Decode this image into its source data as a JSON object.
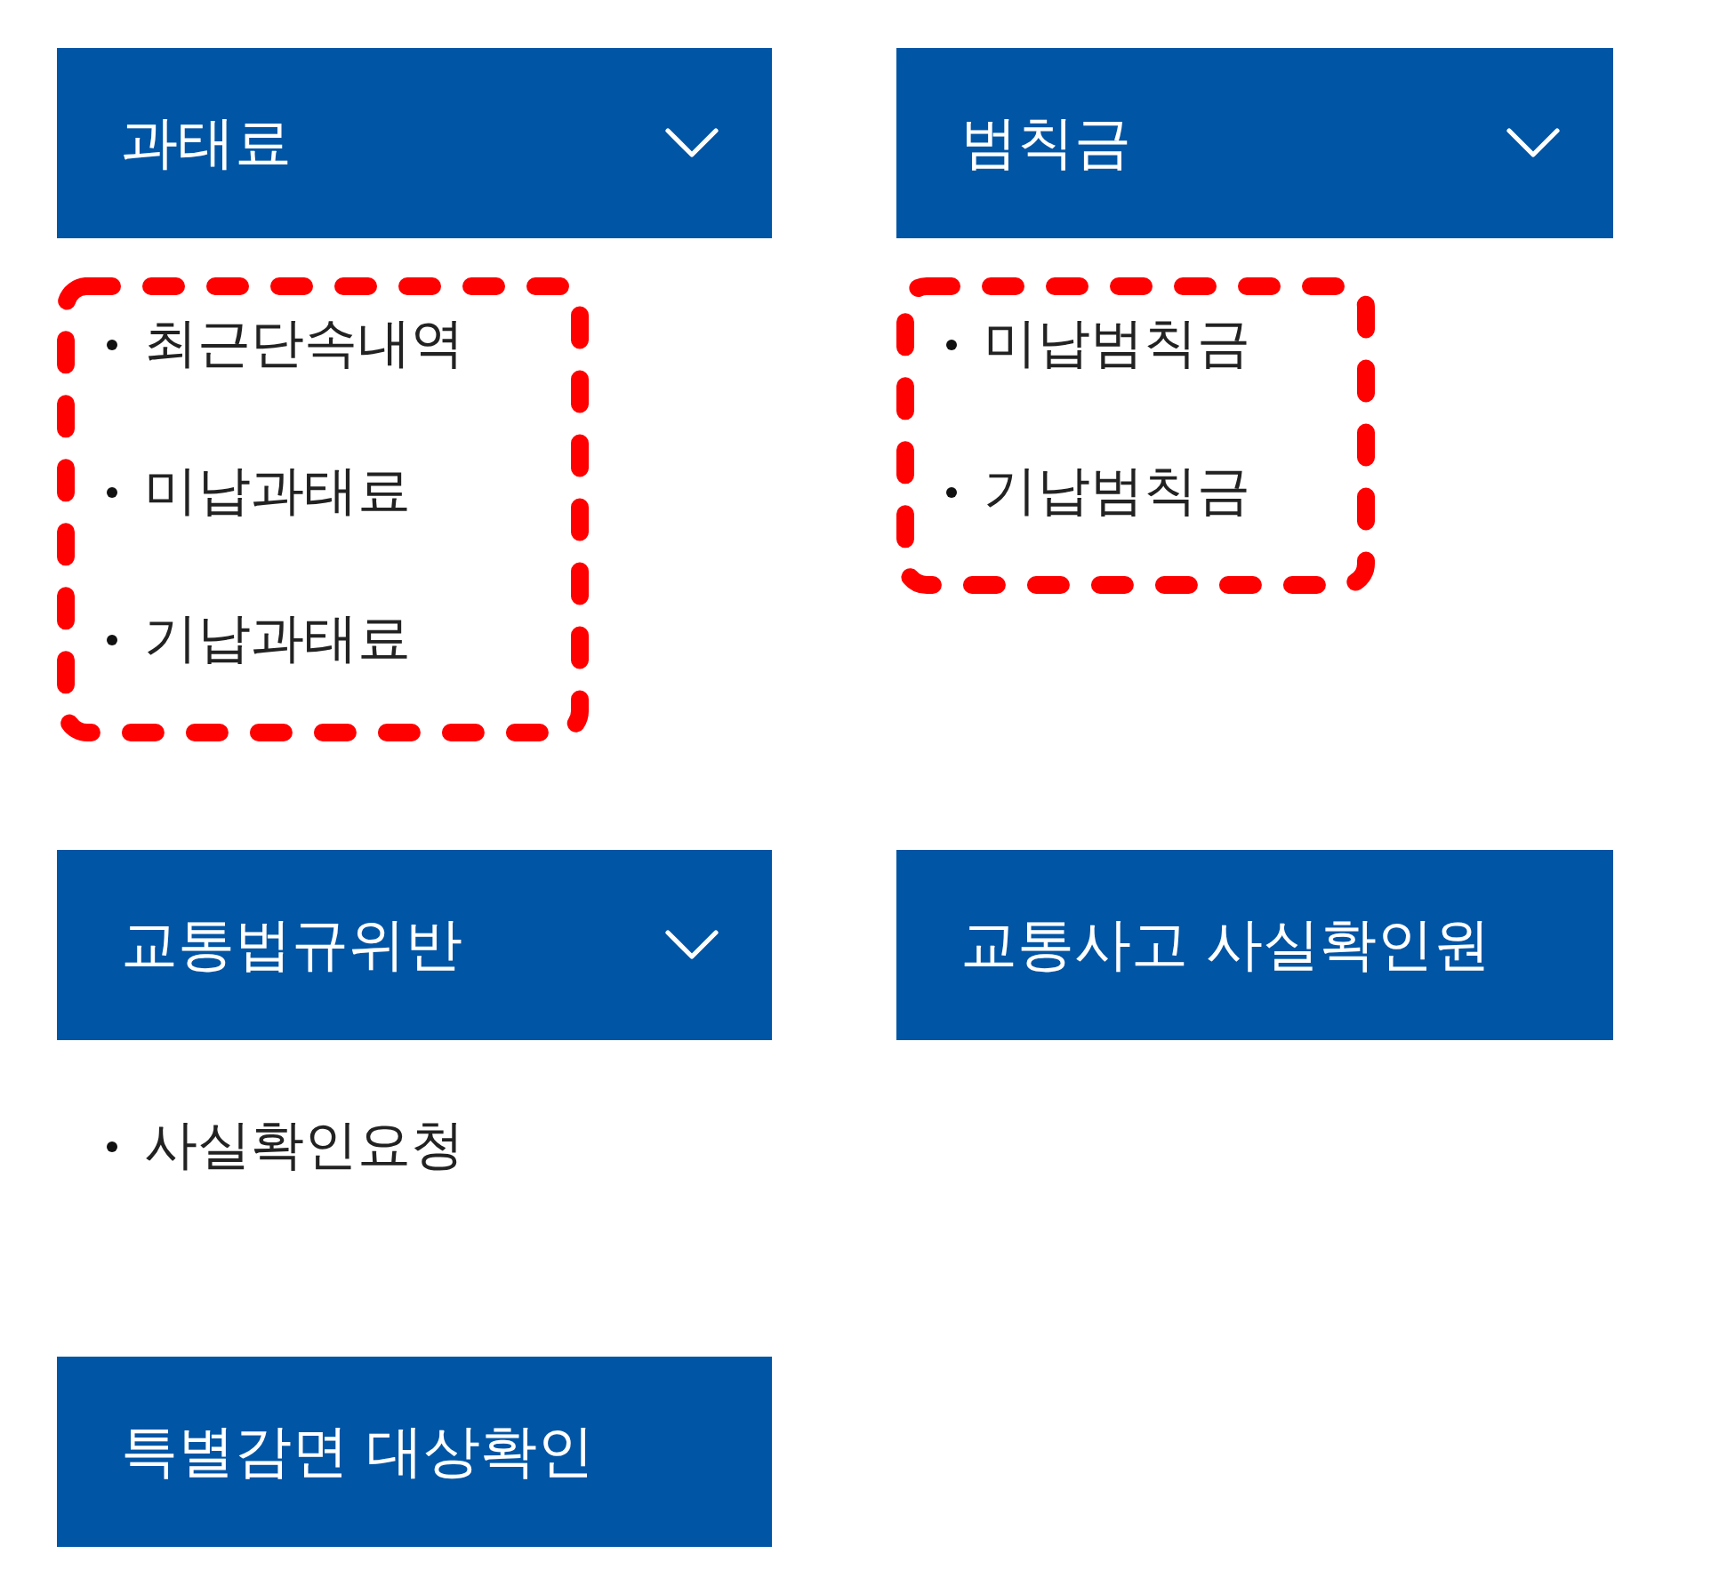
{
  "sections": [
    {
      "title": "과태료",
      "kind": "dropdown",
      "highlighted": true,
      "items": [
        "최근단속내역",
        "미납과태료",
        "기납과태료"
      ]
    },
    {
      "title": "범칙금",
      "kind": "dropdown",
      "highlighted": true,
      "items": [
        "미납범칙금",
        "기납범칙금"
      ]
    },
    {
      "title": "교통법규위반",
      "kind": "dropdown",
      "highlighted": false,
      "items": [
        "사실확인요청"
      ]
    },
    {
      "title": "교통사고 사실확인원",
      "kind": "link"
    },
    {
      "title": "특별감면 대상확인",
      "kind": "link"
    }
  ]
}
